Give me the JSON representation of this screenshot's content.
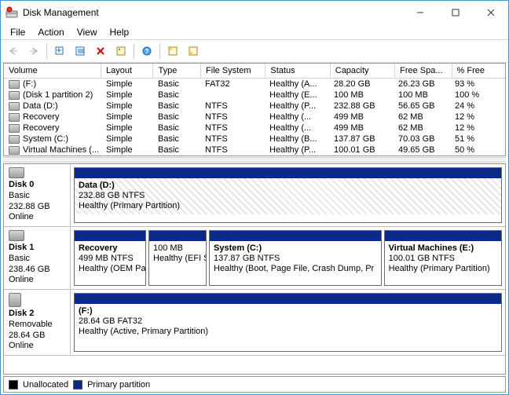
{
  "window": {
    "title": "Disk Management"
  },
  "menu": {
    "file": "File",
    "action": "Action",
    "view": "View",
    "help": "Help"
  },
  "columns": {
    "volume": "Volume",
    "layout": "Layout",
    "type": "Type",
    "fs": "File System",
    "status": "Status",
    "capacity": "Capacity",
    "free": "Free Spa...",
    "pct": "% Free"
  },
  "volumes": [
    {
      "name": "(F:)",
      "layout": "Simple",
      "type": "Basic",
      "fs": "FAT32",
      "status": "Healthy (A...",
      "cap": "28.20 GB",
      "free": "26.23 GB",
      "pct": "93 %"
    },
    {
      "name": "(Disk 1 partition 2)",
      "layout": "Simple",
      "type": "Basic",
      "fs": "",
      "status": "Healthy (E...",
      "cap": "100 MB",
      "free": "100 MB",
      "pct": "100 %"
    },
    {
      "name": "Data (D:)",
      "layout": "Simple",
      "type": "Basic",
      "fs": "NTFS",
      "status": "Healthy (P...",
      "cap": "232.88 GB",
      "free": "56.65 GB",
      "pct": "24 %"
    },
    {
      "name": "Recovery",
      "layout": "Simple",
      "type": "Basic",
      "fs": "NTFS",
      "status": "Healthy (...",
      "cap": "499 MB",
      "free": "62 MB",
      "pct": "12 %"
    },
    {
      "name": "Recovery",
      "layout": "Simple",
      "type": "Basic",
      "fs": "NTFS",
      "status": "Healthy (...",
      "cap": "499 MB",
      "free": "62 MB",
      "pct": "12 %"
    },
    {
      "name": "System (C:)",
      "layout": "Simple",
      "type": "Basic",
      "fs": "NTFS",
      "status": "Healthy (B...",
      "cap": "137.87 GB",
      "free": "70.03 GB",
      "pct": "51 %"
    },
    {
      "name": "Virtual Machines (...",
      "layout": "Simple",
      "type": "Basic",
      "fs": "NTFS",
      "status": "Healthy (P...",
      "cap": "100.01 GB",
      "free": "49.65 GB",
      "pct": "50 %"
    }
  ],
  "disks": [
    {
      "label": "Disk 0",
      "type": "Basic",
      "size": "232.88 GB",
      "state": "Online",
      "parts": [
        {
          "title": "Data  (D:)",
          "line2": "232.88 GB NTFS",
          "line3": "Healthy (Primary Partition)",
          "flex": "1",
          "hatched": true
        }
      ]
    },
    {
      "label": "Disk 1",
      "type": "Basic",
      "size": "238.46 GB",
      "state": "Online",
      "parts": [
        {
          "title": "Recovery",
          "line2": "499 MB NTFS",
          "line3": "Healthy (OEM Partit",
          "flex": "0 0 90px"
        },
        {
          "title": "",
          "line2": "100 MB",
          "line3": "Healthy (EFI S)",
          "flex": "0 0 72px"
        },
        {
          "title": "System  (C:)",
          "line2": "137.87 GB NTFS",
          "line3": "Healthy (Boot, Page File, Crash Dump, Pr",
          "flex": "2.2"
        },
        {
          "title": "Virtual Machines  (E:)",
          "line2": "100.01 GB NTFS",
          "line3": "Healthy (Primary Partition)",
          "flex": "1.5"
        }
      ]
    },
    {
      "label": "Disk 2",
      "type": "Removable",
      "size": "28.64 GB",
      "state": "Online",
      "parts": [
        {
          "title": "(F:)",
          "line2": "28.64 GB FAT32",
          "line3": "Healthy (Active, Primary Partition)",
          "flex": "1"
        }
      ]
    }
  ],
  "legend": {
    "unallocated": "Unallocated",
    "primary": "Primary partition"
  }
}
